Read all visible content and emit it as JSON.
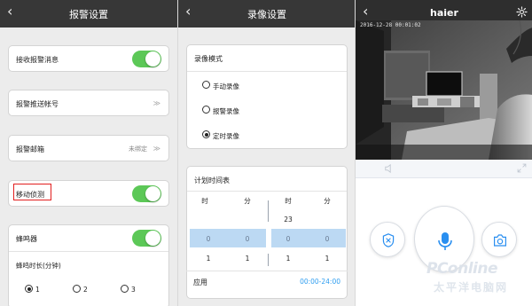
{
  "alarm_settings": {
    "title": "报警设置",
    "receive_alarm_label": "接收报警消息",
    "push_account_label": "报警推送帐号",
    "alarm_email_label": "报警邮箱",
    "alarm_email_status": "未绑定",
    "motion_detection_label": "移动侦测",
    "buzzer_label": "蜂鸣器",
    "buzzer_duration_label": "蜂鸣时长(分钟)",
    "duration_options": [
      "1",
      "2",
      "3"
    ],
    "selected_duration": "1",
    "receive_alarm_on": true,
    "motion_detection_on": true,
    "buzzer_on": true
  },
  "recording_settings": {
    "title": "录像设置",
    "mode_title": "录像模式",
    "modes": [
      "手动录像",
      "报警录像",
      "定时录像"
    ],
    "selected_mode": "定时录像",
    "schedule_title": "计划时间表",
    "col_headers": [
      "时",
      "分",
      "时",
      "分"
    ],
    "row1": [
      "",
      "",
      "23",
      ""
    ],
    "row2": [
      "0",
      "0",
      "0",
      "0"
    ],
    "row3": [
      "1",
      "1",
      "1",
      "1"
    ],
    "apply_label": "应用",
    "apply_range": "00:00-24:00"
  },
  "camera_view": {
    "title": "haier",
    "timestamp": "2016-12-28 00:01:02",
    "watermark_main": "PConline",
    "watermark_sub": "太平洋电脑网"
  },
  "colors": {
    "topbar": "#373737",
    "toggle_on": "#5cc857",
    "highlight_red": "#e21f1f",
    "selected_row": "#bcd9f3",
    "accent_blue": "#2f9ef0",
    "mic_blue": "#2a8ff0"
  },
  "icons": [
    "back-chevron-icon",
    "gear-icon",
    "speaker-icon",
    "fullscreen-icon",
    "shield-icon",
    "microphone-icon",
    "camera-icon",
    "chevron-right-icon"
  ]
}
